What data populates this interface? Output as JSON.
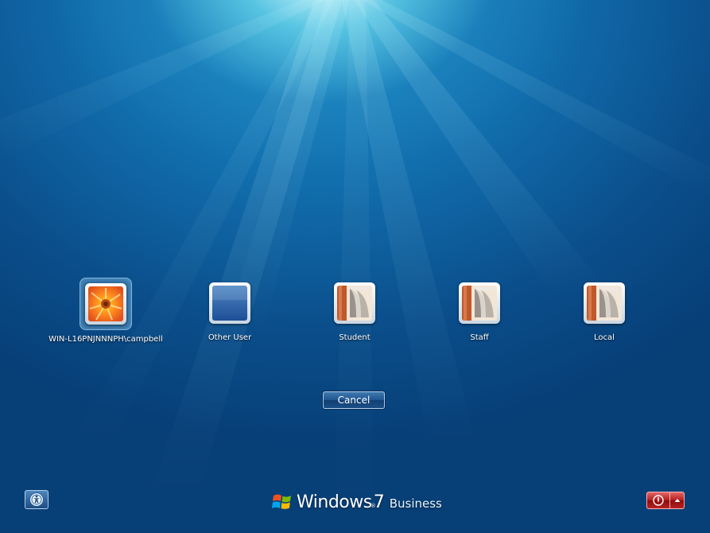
{
  "users": [
    {
      "name": "WIN-L16PNJNNNPH\\campbell",
      "picture": "flower-picture",
      "selected": true
    },
    {
      "name": "Other User",
      "picture": "blank-picture",
      "selected": false
    },
    {
      "name": "Student",
      "picture": "book-picture",
      "selected": false
    },
    {
      "name": "Staff",
      "picture": "book-picture",
      "selected": false
    },
    {
      "name": "Local",
      "picture": "book-picture",
      "selected": false
    }
  ],
  "buttons": {
    "cancel_label": "Cancel"
  },
  "branding": {
    "word1": "Windows",
    "trademark": "®",
    "word2": "7",
    "edition": "Business"
  },
  "icons": {
    "ease_of_access": "ease-of-access-icon",
    "power": "power-icon",
    "power_menu": "caret-up-icon"
  },
  "colors": {
    "background_top": "#1e8cc4",
    "background_bottom": "#073f77",
    "power_red": "#b21d1d"
  }
}
